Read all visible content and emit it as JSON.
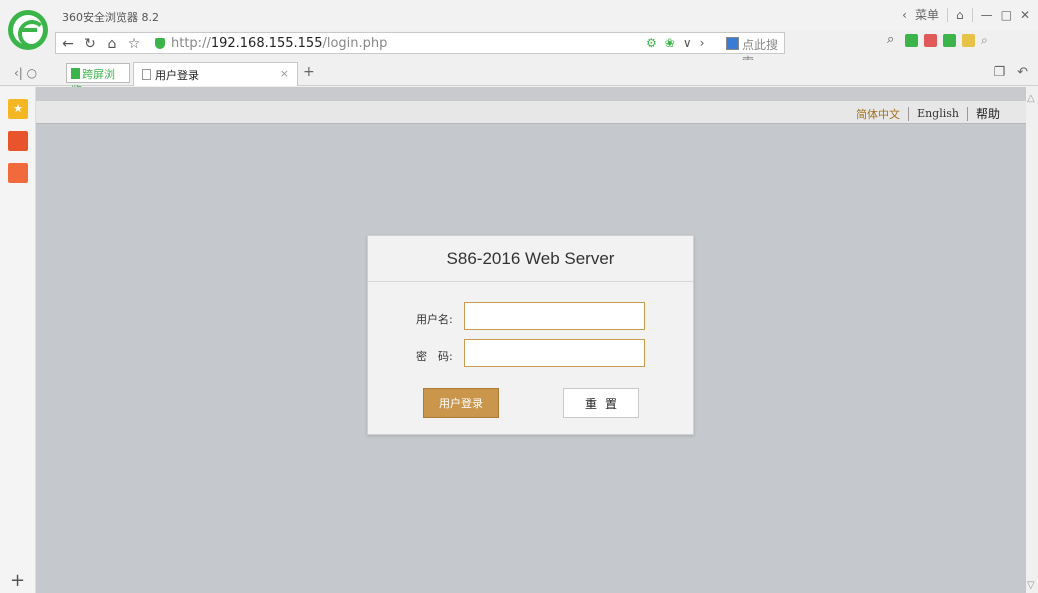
{
  "browser": {
    "app_title": "360安全浏览器 8.2",
    "menu_label": "菜单",
    "url_scheme": "http://",
    "url_host": "192.168.155.155",
    "url_path": "/login.php",
    "search_placeholder": "点此搜索",
    "tabs": [
      {
        "label": "跨屏浏览"
      },
      {
        "label": "用户登录"
      }
    ],
    "accent_color": "#3bb54a"
  },
  "page": {
    "languages": {
      "zh": "简体中文",
      "en": "English",
      "help": "帮助"
    },
    "login": {
      "title": "S86-2016 Web Server",
      "username_label": "用户名:",
      "password_label": "密　码:",
      "username_value": "",
      "password_value": "",
      "login_button": "用户登录",
      "reset_button": "重置"
    },
    "colors": {
      "button_gold": "#c9964c",
      "input_border": "#c99b4f",
      "page_background": "#c5c8cc"
    }
  }
}
